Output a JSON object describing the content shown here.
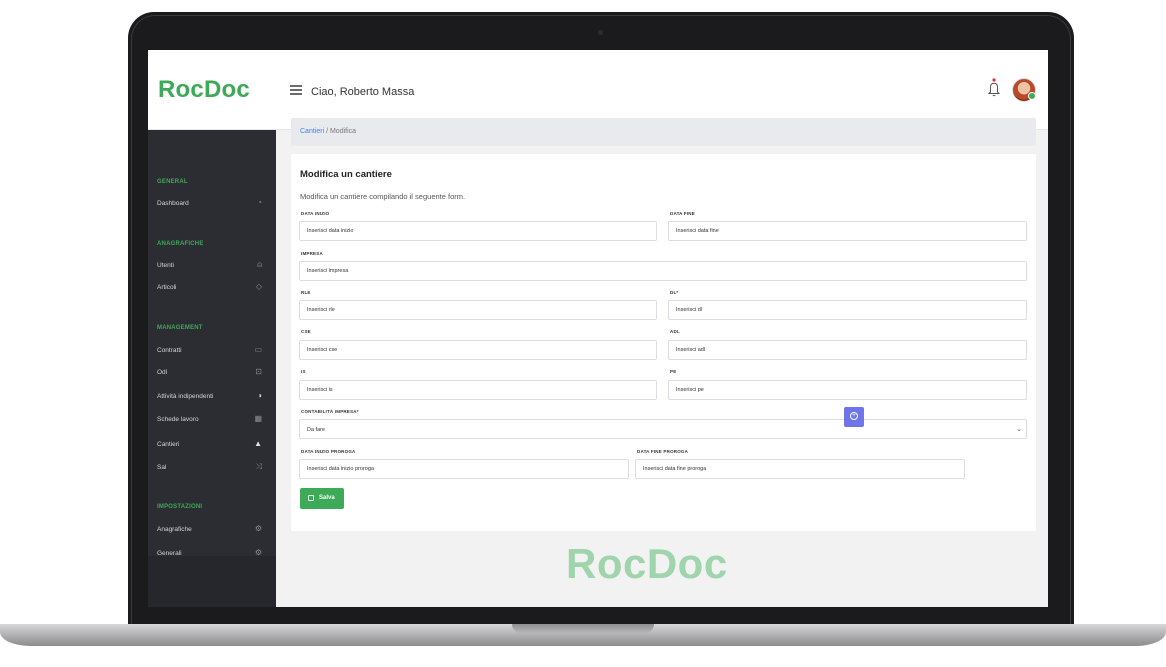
{
  "app": {
    "logo": "RocDoc",
    "watermark": "RocDoc"
  },
  "header": {
    "greeting": "Ciao, Roberto Massa"
  },
  "sidebar": {
    "general": {
      "heading": "GENERAL",
      "items": [
        {
          "label": "Dashboard",
          "icon": "gauge-icon"
        }
      ]
    },
    "anagrafiche": {
      "heading": "ANAGRAFICHE",
      "items": [
        {
          "label": "Utenti",
          "icon": "user-icon"
        },
        {
          "label": "Articoli",
          "icon": "tag-icon"
        }
      ]
    },
    "management": {
      "heading": "MANAGEMENT",
      "items": [
        {
          "label": "Contratti",
          "icon": "folder-icon"
        },
        {
          "label": "Odl",
          "icon": "briefcase-icon"
        },
        {
          "label": "Attività indipendenti",
          "icon": "half-circle-icon"
        },
        {
          "label": "Schede lavoro",
          "icon": "grid-icon"
        },
        {
          "label": "Cantieri",
          "icon": "warning-icon"
        },
        {
          "label": "Sal",
          "icon": "shuffle-icon"
        }
      ]
    },
    "impostazioni": {
      "heading": "IMPOSTAZIONI",
      "items": [
        {
          "label": "Anagrafiche",
          "icon": "gear-icon"
        },
        {
          "label": "Generali",
          "icon": "gear-icon"
        }
      ]
    }
  },
  "breadcrumb": {
    "parent": "Cantieri",
    "separator": " / ",
    "current": "Modifica"
  },
  "form": {
    "title": "Modifica un cantiere",
    "subtitle": "Modifica un cantiere compilando il seguente form.",
    "fields": {
      "data_inizio": {
        "label": "DATA INIZIO",
        "placeholder": "Inserisci data inizio"
      },
      "data_fine": {
        "label": "DATA FINE",
        "placeholder": "Inserisci data fine"
      },
      "impresa": {
        "label": "IMPRESA",
        "placeholder": "Inserisci impresa"
      },
      "rle": {
        "label": "RLE",
        "placeholder": "Inserisci rle"
      },
      "dl": {
        "label": "DL*",
        "placeholder": "Inserisci dl"
      },
      "cse": {
        "label": "CSE",
        "placeholder": "Inserisci cse"
      },
      "adl": {
        "label": "ADL",
        "placeholder": "Inserisci adl"
      },
      "is": {
        "label": "IS",
        "placeholder": "Inserisci is"
      },
      "pe": {
        "label": "PE",
        "placeholder": "Inserisci pe"
      },
      "contabilita_impresa": {
        "label": "CONTABILITÀ IMPRESA*",
        "value": "Da fare"
      },
      "data_inizio_proroga": {
        "label": "DATA INIZIO PROROGA",
        "placeholder": "Inserisci data inizio proroga"
      },
      "data_fine_proroga": {
        "label": "DATA FINE PROROGA",
        "placeholder": "Inserisci data fine proroga"
      }
    },
    "save_label": "Salva"
  },
  "colors": {
    "brand": "#3daa58",
    "sidebar": "#2b2d33",
    "add_button": "#6f74e8",
    "link": "#3b82f6"
  }
}
